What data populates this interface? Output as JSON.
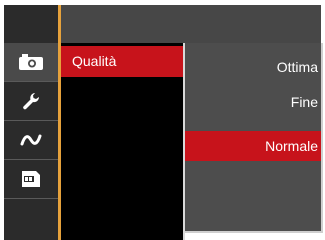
{
  "sidebar": {
    "items": [
      {
        "icon": "camera-icon",
        "active": true
      },
      {
        "icon": "wrench-icon",
        "active": false
      },
      {
        "icon": "wave-icon",
        "active": false
      },
      {
        "icon": "sd-card-icon",
        "active": false
      }
    ]
  },
  "menu": {
    "items": [
      {
        "label": "Qualità",
        "selected": true
      }
    ]
  },
  "options": {
    "items": [
      {
        "label": "Ottima",
        "selected": false
      },
      {
        "label": "Fine",
        "selected": false
      },
      {
        "label": "Normale",
        "selected": true
      }
    ]
  },
  "colors": {
    "accent_red": "#c7131b",
    "orange_bar": "#e6a23c",
    "rail_bg": "#2b2b2b",
    "panel_bg": "#4d4d4d"
  }
}
